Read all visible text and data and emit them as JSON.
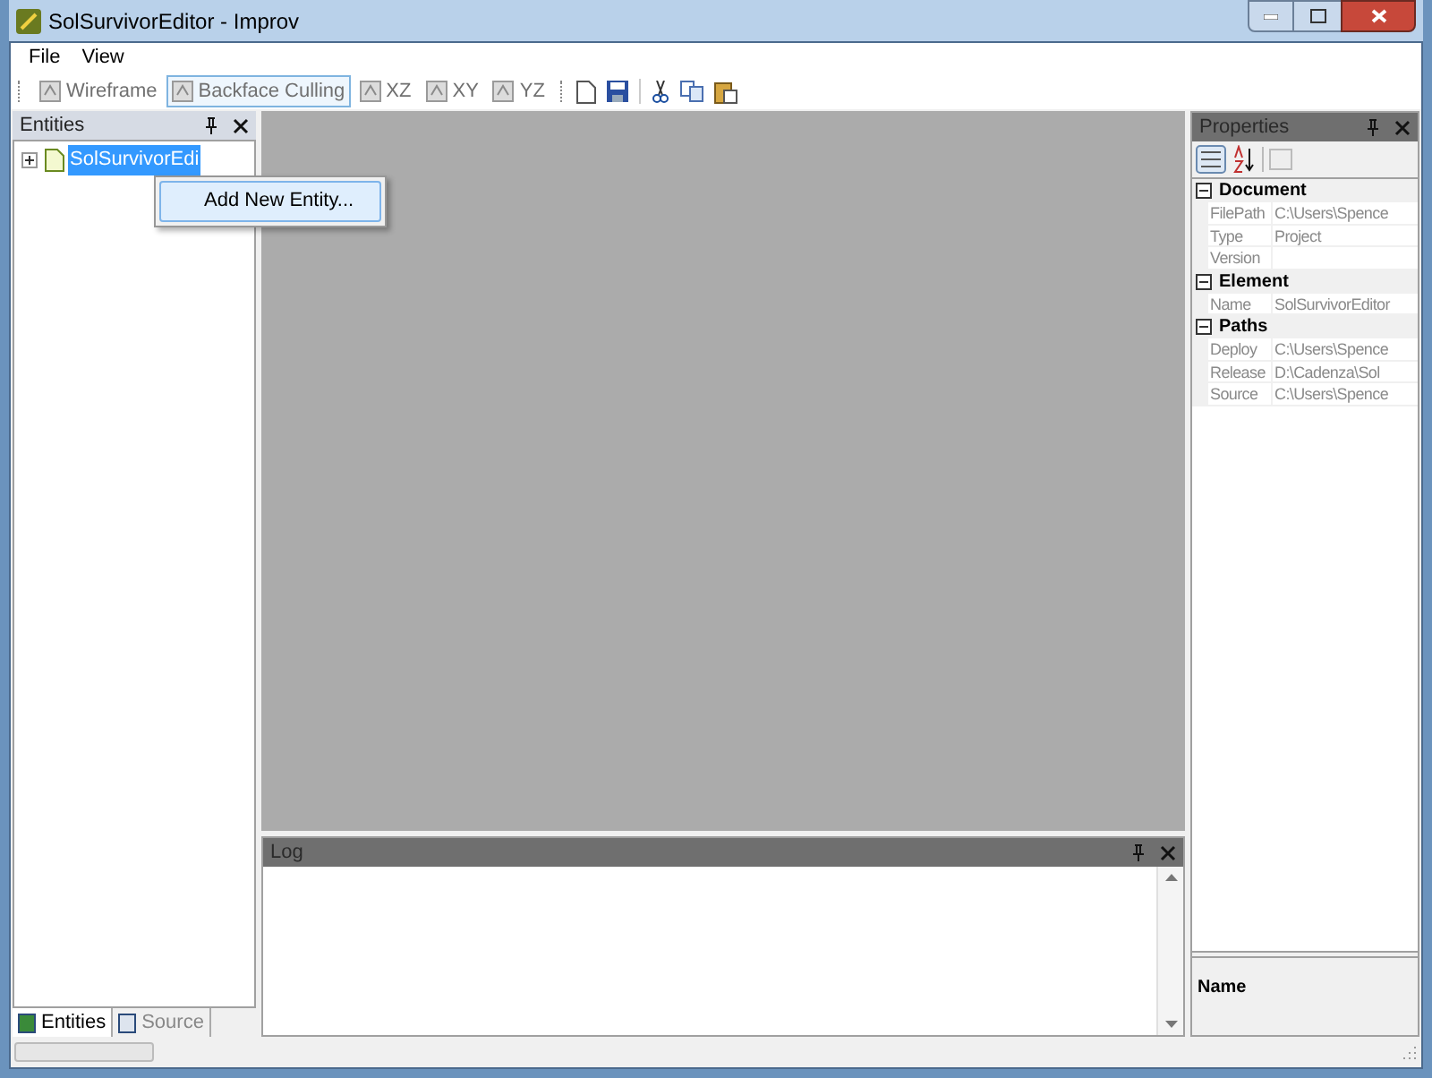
{
  "window": {
    "title": "SolSurvivorEditor - Improv"
  },
  "menu": [
    "File",
    "View"
  ],
  "toolbar": {
    "toggles": [
      {
        "label": "Wireframe",
        "checked": false
      },
      {
        "label": "Backface Culling",
        "checked": true
      },
      {
        "label": "XZ",
        "checked": false
      },
      {
        "label": "XY",
        "checked": false
      },
      {
        "label": "YZ",
        "checked": false
      }
    ]
  },
  "entities_panel": {
    "title": "Entities",
    "tree": [
      {
        "label": "SolSurvivorEdi",
        "selected": true,
        "expanded": false
      }
    ],
    "context_menu": [
      "Add New Entity..."
    ],
    "tabs": [
      {
        "label": "Entities",
        "selected": true
      },
      {
        "label": "Source",
        "selected": false
      }
    ]
  },
  "log_panel": {
    "title": "Log"
  },
  "properties_panel": {
    "title": "Properties",
    "groups": [
      {
        "name": "Document",
        "rows": [
          {
            "key": "FilePath",
            "value": "C:\\Users\\Spence"
          },
          {
            "key": "Type",
            "value": "Project"
          },
          {
            "key": "Version",
            "value": ""
          }
        ]
      },
      {
        "name": "Element",
        "rows": [
          {
            "key": "Name",
            "value": "SolSurvivorEditor"
          }
        ]
      },
      {
        "name": "Paths",
        "rows": [
          {
            "key": "Deploy",
            "value": "C:\\Users\\Spence"
          },
          {
            "key": "Release",
            "value": "D:\\Cadenza\\Sol"
          },
          {
            "key": "Source",
            "value": "C:\\Users\\Spence"
          }
        ]
      }
    ],
    "description_title": "Name"
  },
  "status_bar": {
    "progress": {
      "level": 0
    }
  }
}
